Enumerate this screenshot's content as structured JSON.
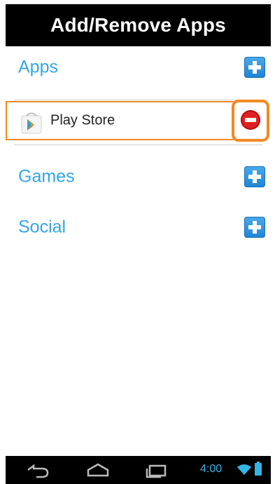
{
  "title": "Add/Remove Apps",
  "sections": [
    {
      "label": "Apps"
    },
    {
      "label": "Games"
    },
    {
      "label": "Social"
    }
  ],
  "apps_list": [
    {
      "name": "Play Store",
      "icon": "play-store-icon"
    }
  ],
  "status": {
    "time": "4:00"
  },
  "colors": {
    "accent_blue": "#33a6e6",
    "highlight_orange": "#f08a24",
    "remove_red": "#e02121"
  },
  "icons": {
    "add": "plus-square-icon",
    "remove": "minus-circle-icon",
    "nav_back": "back-arrow-icon",
    "nav_home": "home-icon",
    "nav_recent": "recent-apps-icon",
    "wifi": "wifi-icon",
    "battery": "battery-icon"
  }
}
